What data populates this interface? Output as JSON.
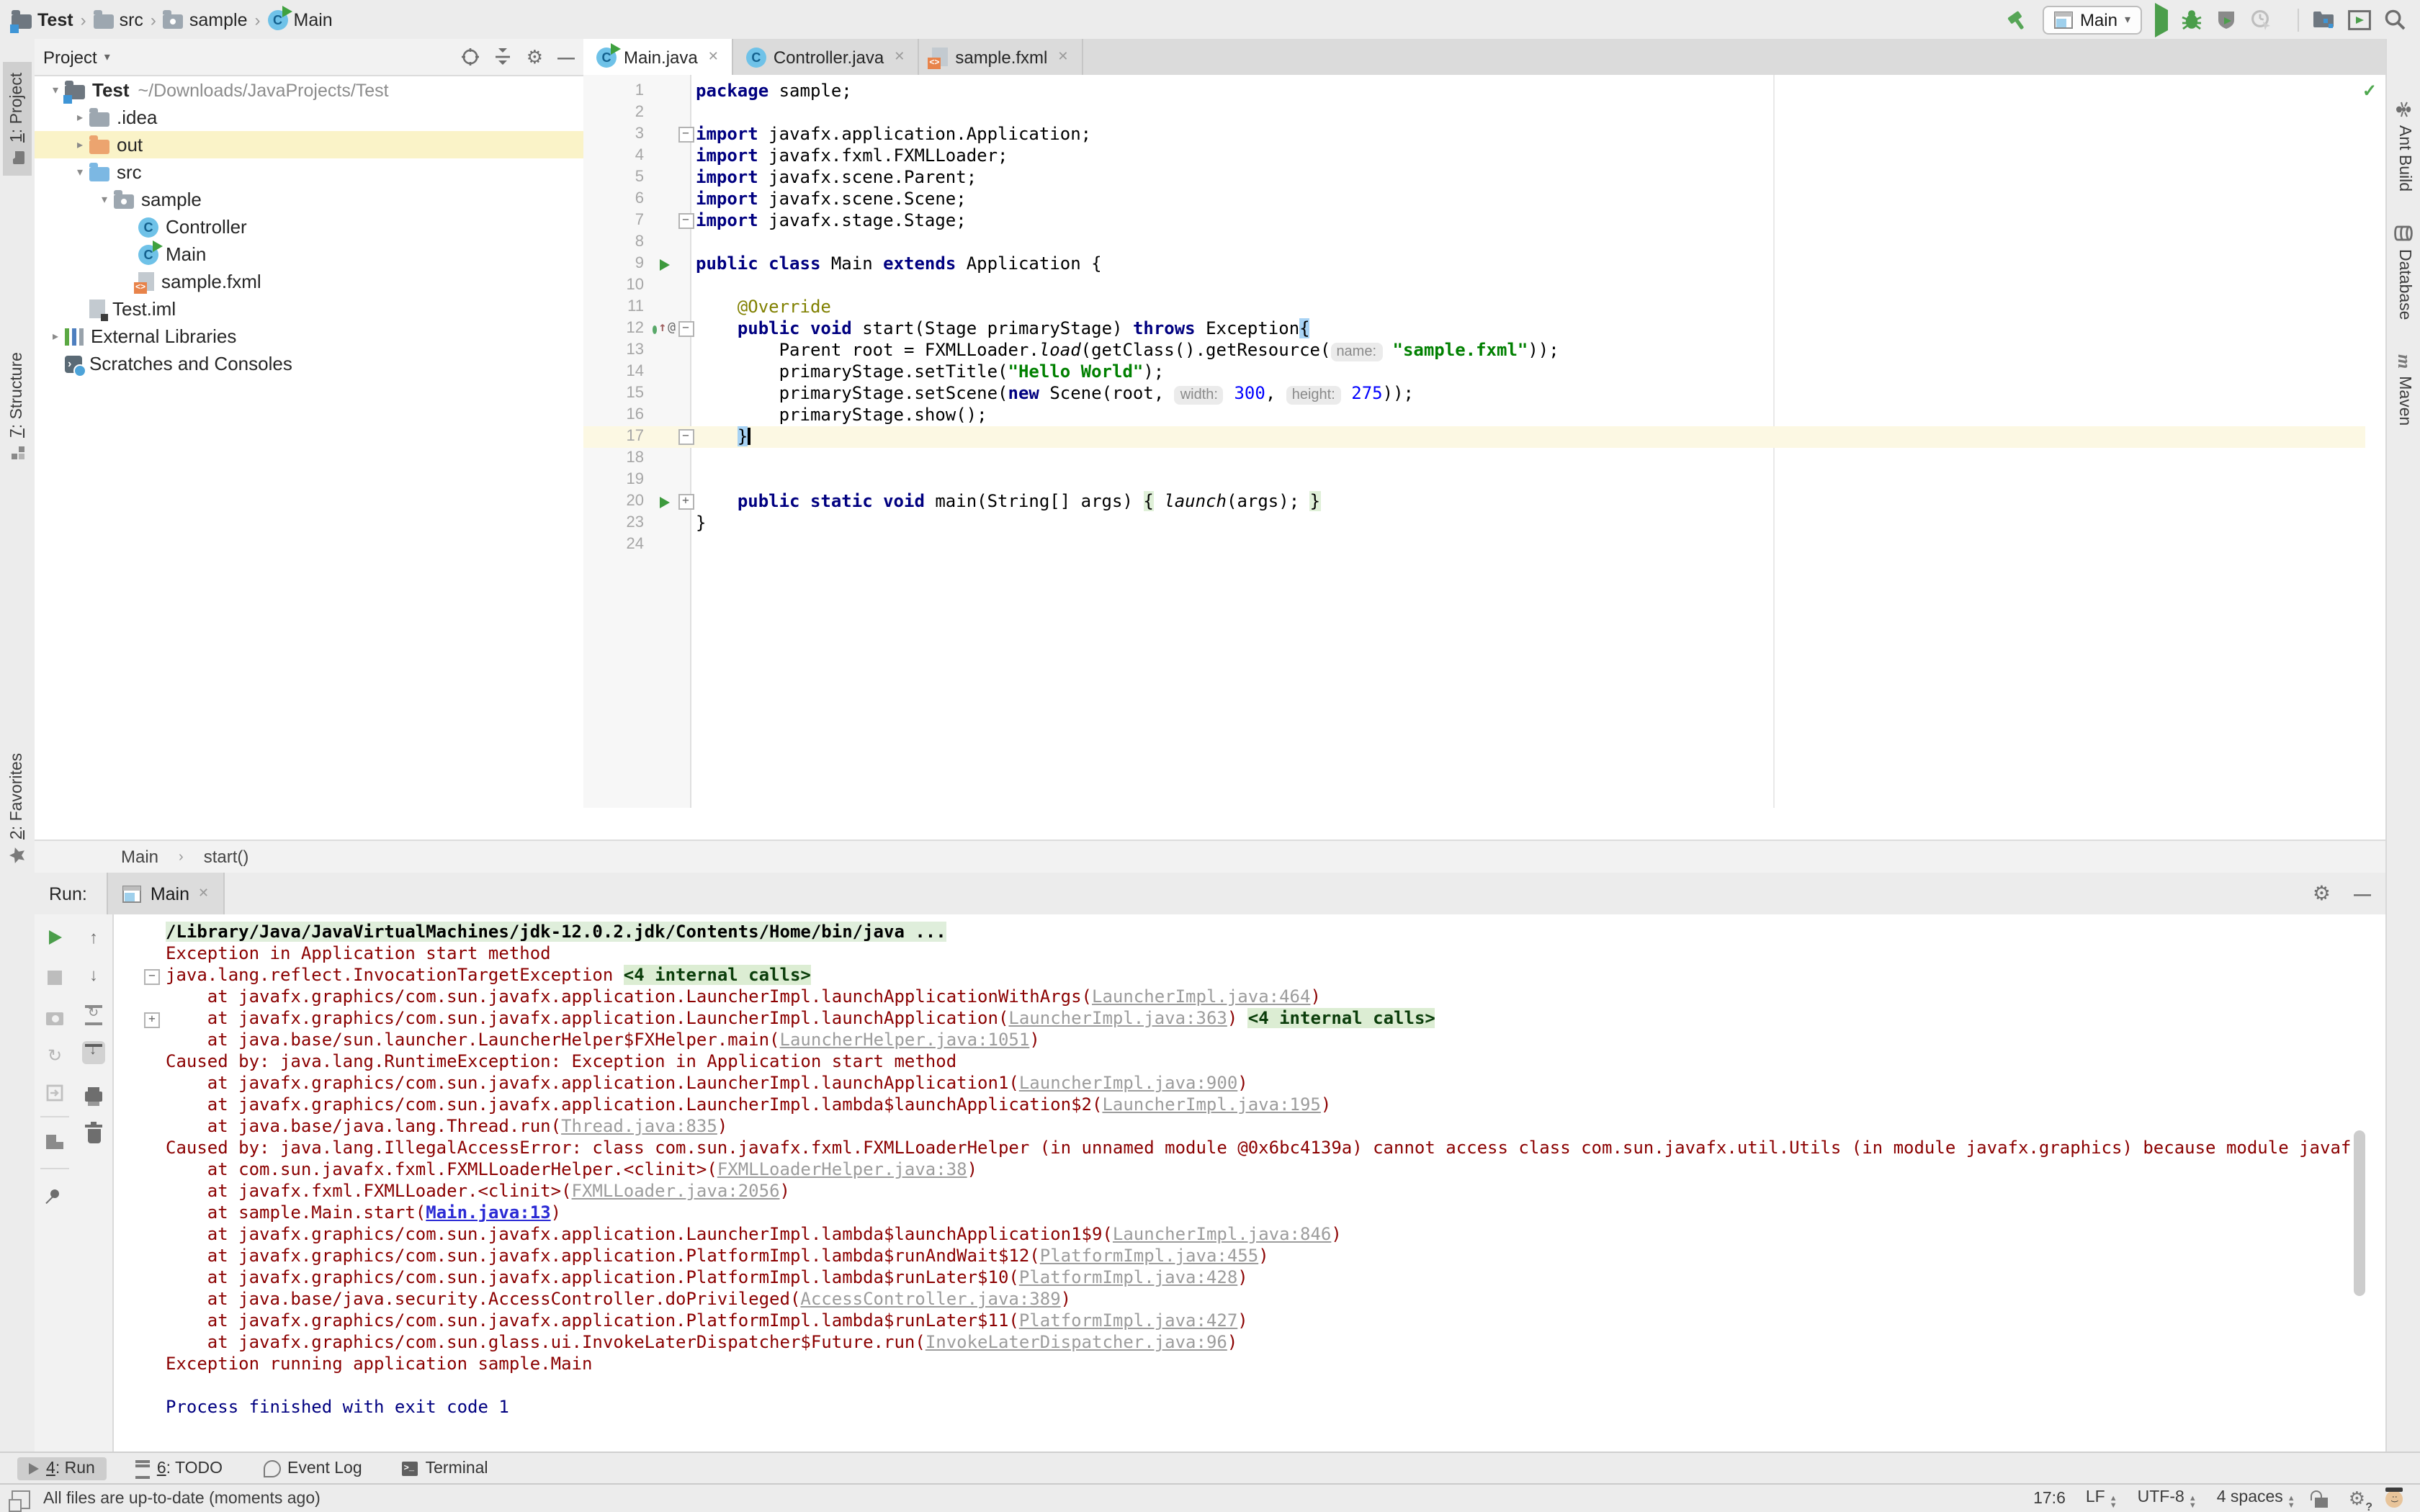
{
  "window": {
    "breadcrumbs": [
      {
        "label": "Test",
        "icon": "project"
      },
      {
        "label": "src",
        "icon": "folder-gray"
      },
      {
        "label": "sample",
        "icon": "package"
      },
      {
        "label": "Main",
        "icon": "class"
      }
    ]
  },
  "toolbar": {
    "run_config": "Main",
    "icons": [
      "build-hammer",
      "run",
      "debug",
      "run-with-coverage",
      "profiler",
      "stop",
      "project-structure",
      "run-anything",
      "search-everywhere"
    ]
  },
  "left_strip": {
    "items": [
      {
        "mnemonic": "1",
        "rest": ": Project",
        "icon": "project-tool",
        "active": true
      },
      {
        "mnemonic": "7",
        "rest": ": Structure",
        "icon": "structure-tool",
        "active": false
      },
      {
        "mnemonic": "2",
        "rest": ": Favorites",
        "icon": "star",
        "active": false
      }
    ]
  },
  "right_strip": {
    "items": [
      {
        "label": "Ant Build",
        "icon": "ant"
      },
      {
        "label": "Database",
        "icon": "database"
      },
      {
        "label": "Maven",
        "icon": "maven"
      }
    ]
  },
  "project_panel": {
    "title": "Project",
    "tree": [
      {
        "label": "Test",
        "path": "~/Downloads/JavaProjects/Test",
        "level": 0,
        "icon": "project",
        "arrow": "expanded",
        "bold": true,
        "selected": false
      },
      {
        "label": ".idea",
        "level": 1,
        "icon": "folder-gray",
        "arrow": "collapsed",
        "selected": false
      },
      {
        "label": "out",
        "level": 1,
        "icon": "folder-orange",
        "arrow": "collapsed",
        "selected": true
      },
      {
        "label": "src",
        "level": 1,
        "icon": "folder-blue",
        "arrow": "expanded",
        "selected": false
      },
      {
        "label": "sample",
        "level": 2,
        "icon": "package",
        "arrow": "expanded",
        "selected": false
      },
      {
        "label": "Controller",
        "level": 3,
        "icon": "class",
        "arrow": "none",
        "selected": false
      },
      {
        "label": "Main",
        "level": 3,
        "icon": "classrun",
        "arrow": "none",
        "selected": false
      },
      {
        "label": "sample.fxml",
        "level": 3,
        "icon": "fxml",
        "arrow": "none",
        "selected": false
      },
      {
        "label": "Test.iml",
        "level": 1,
        "icon": "file",
        "arrow": "none",
        "selected": false
      },
      {
        "label": "External Libraries",
        "level": 0,
        "icon": "libs",
        "arrow": "collapsed",
        "selected": false
      },
      {
        "label": "Scratches and Consoles",
        "level": 0,
        "icon": "scratch",
        "arrow": "none",
        "selected": false
      }
    ]
  },
  "editor": {
    "tabs": [
      {
        "label": "Main.java",
        "icon": "classrun",
        "active": true
      },
      {
        "label": "Controller.java",
        "icon": "class",
        "active": false
      },
      {
        "label": "sample.fxml",
        "icon": "fxml",
        "active": false
      }
    ],
    "breadcrumb": {
      "class": "Main",
      "method": "start()"
    },
    "lines": [
      {
        "num": "1",
        "segs": [
          {
            "t": "k",
            "s": "package"
          },
          {
            "t": "p",
            "s": " sample;"
          }
        ]
      },
      {
        "num": "2",
        "segs": []
      },
      {
        "num": "3",
        "fold": "minus",
        "segs": [
          {
            "t": "k",
            "s": "import"
          },
          {
            "t": "p",
            "s": " javafx.application.Application;"
          }
        ]
      },
      {
        "num": "4",
        "segs": [
          {
            "t": "k",
            "s": "import"
          },
          {
            "t": "p",
            "s": " javafx.fxml.FXMLLoader;"
          }
        ]
      },
      {
        "num": "5",
        "segs": [
          {
            "t": "k",
            "s": "import"
          },
          {
            "t": "p",
            "s": " javafx.scene.Parent;"
          }
        ]
      },
      {
        "num": "6",
        "segs": [
          {
            "t": "k",
            "s": "import"
          },
          {
            "t": "p",
            "s": " javafx.scene.Scene;"
          }
        ]
      },
      {
        "num": "7",
        "fold": "minus",
        "segs": [
          {
            "t": "k",
            "s": "import"
          },
          {
            "t": "p",
            "s": " javafx.stage.Stage;"
          }
        ]
      },
      {
        "num": "8",
        "segs": []
      },
      {
        "num": "9",
        "gutter": "run",
        "segs": [
          {
            "t": "k",
            "s": "public class"
          },
          {
            "t": "p",
            "s": " Main "
          },
          {
            "t": "k",
            "s": "extends"
          },
          {
            "t": "p",
            "s": " Application {"
          }
        ]
      },
      {
        "num": "10",
        "segs": []
      },
      {
        "num": "11",
        "segs": [
          {
            "t": "a",
            "s": "    @Override"
          }
        ]
      },
      {
        "num": "12",
        "gutter": "override",
        "fold": "minus",
        "segs": [
          {
            "t": "p",
            "s": "    "
          },
          {
            "t": "k",
            "s": "public void"
          },
          {
            "t": "p",
            "s": " start(Stage primaryStage) "
          },
          {
            "t": "k",
            "s": "throws"
          },
          {
            "t": "p",
            "s": " Exception"
          },
          {
            "t": "b",
            "s": "{"
          }
        ]
      },
      {
        "num": "13",
        "segs": [
          {
            "t": "p",
            "s": "        Parent root = FXMLLoader."
          },
          {
            "t": "i",
            "s": "load"
          },
          {
            "t": "p",
            "s": "(getClass().getResource("
          },
          {
            "t": "h",
            "s": "name:"
          },
          {
            "t": "p",
            "s": " "
          },
          {
            "t": "s",
            "s": "\"sample.fxml\""
          },
          {
            "t": "p",
            "s": "));"
          }
        ]
      },
      {
        "num": "14",
        "segs": [
          {
            "t": "p",
            "s": "        primaryStage.setTitle("
          },
          {
            "t": "s",
            "s": "\"Hello World\""
          },
          {
            "t": "p",
            "s": ");"
          }
        ]
      },
      {
        "num": "15",
        "segs": [
          {
            "t": "p",
            "s": "        primaryStage.setScene("
          },
          {
            "t": "k",
            "s": "new"
          },
          {
            "t": "p",
            "s": " Scene(root, "
          },
          {
            "t": "h",
            "s": "width:"
          },
          {
            "t": "p",
            "s": " "
          },
          {
            "t": "n",
            "s": "300"
          },
          {
            "t": "p",
            "s": ", "
          },
          {
            "t": "h",
            "s": "height:"
          },
          {
            "t": "p",
            "s": " "
          },
          {
            "t": "n",
            "s": "275"
          },
          {
            "t": "p",
            "s": "));"
          }
        ]
      },
      {
        "num": "16",
        "segs": [
          {
            "t": "p",
            "s": "        primaryStage.show();"
          }
        ]
      },
      {
        "num": "17",
        "fold": "minus",
        "highlight": true,
        "caret": true,
        "segs": [
          {
            "t": "p",
            "s": "    "
          },
          {
            "t": "b",
            "s": "}"
          }
        ]
      },
      {
        "num": "18",
        "segs": []
      },
      {
        "num": "19",
        "segs": []
      },
      {
        "num": "20",
        "gutter": "run",
        "fold": "plus",
        "segs": [
          {
            "t": "p",
            "s": "    "
          },
          {
            "t": "k",
            "s": "public static void"
          },
          {
            "t": "p",
            "s": " main(String[] args) "
          },
          {
            "t": "g",
            "s": "{"
          },
          {
            "t": "p",
            "s": " "
          },
          {
            "t": "i",
            "s": "launch"
          },
          {
            "t": "p",
            "s": "(args); "
          },
          {
            "t": "g",
            "s": "}"
          }
        ]
      },
      {
        "num": "23",
        "segs": [
          {
            "t": "p",
            "s": "}"
          }
        ]
      },
      {
        "num": "24",
        "segs": []
      }
    ]
  },
  "run_panel": {
    "label": "Run:",
    "tab": "Main",
    "console": [
      {
        "segs": [
          {
            "t": "c",
            "s": "/Library/Java/JavaVirtualMachines/jdk-12.0.2.jdk/Contents/Home/bin/java ..."
          }
        ]
      },
      {
        "segs": [
          {
            "t": "e",
            "s": "Exception in Application start method"
          }
        ]
      },
      {
        "fold": "minus",
        "segs": [
          {
            "t": "e",
            "s": "java.lang.reflect.InvocationTargetException "
          },
          {
            "t": "g",
            "s": "<4 internal calls>"
          }
        ]
      },
      {
        "segs": [
          {
            "t": "e",
            "s": "    at javafx.graphics/com.sun.javafx.application.LauncherImpl.launchApplicationWithArgs("
          },
          {
            "t": "l",
            "s": "LauncherImpl.java:464"
          },
          {
            "t": "e",
            "s": ")"
          }
        ]
      },
      {
        "fold": "plus",
        "segs": [
          {
            "t": "e",
            "s": "    at javafx.graphics/com.sun.javafx.application.LauncherImpl.launchApplication("
          },
          {
            "t": "l",
            "s": "LauncherImpl.java:363"
          },
          {
            "t": "e",
            "s": ") "
          },
          {
            "t": "g",
            "s": "<4 internal calls>"
          }
        ]
      },
      {
        "segs": [
          {
            "t": "e",
            "s": "    at java.base/sun.launcher.LauncherHelper$FXHelper.main("
          },
          {
            "t": "l",
            "s": "LauncherHelper.java:1051"
          },
          {
            "t": "e",
            "s": ")"
          }
        ]
      },
      {
        "segs": [
          {
            "t": "e",
            "s": "Caused by: java.lang.RuntimeException: Exception in Application start method"
          }
        ]
      },
      {
        "segs": [
          {
            "t": "e",
            "s": "    at javafx.graphics/com.sun.javafx.application.LauncherImpl.launchApplication1("
          },
          {
            "t": "l",
            "s": "LauncherImpl.java:900"
          },
          {
            "t": "e",
            "s": ")"
          }
        ]
      },
      {
        "segs": [
          {
            "t": "e",
            "s": "    at javafx.graphics/com.sun.javafx.application.LauncherImpl.lambda$launchApplication$2("
          },
          {
            "t": "l",
            "s": "LauncherImpl.java:195"
          },
          {
            "t": "e",
            "s": ")"
          }
        ]
      },
      {
        "segs": [
          {
            "t": "e",
            "s": "    at java.base/java.lang.Thread.run("
          },
          {
            "t": "l",
            "s": "Thread.java:835"
          },
          {
            "t": "e",
            "s": ")"
          }
        ]
      },
      {
        "segs": [
          {
            "t": "e",
            "s": "Caused by: java.lang.IllegalAccessError: class com.sun.javafx.fxml.FXMLLoaderHelper (in unnamed module @0x6bc4139a) cannot access class com.sun.javafx.util.Utils (in module javafx.graphics) because module javafx.graphics doe"
          }
        ]
      },
      {
        "segs": [
          {
            "t": "e",
            "s": "    at com.sun.javafx.fxml.FXMLLoaderHelper.<clinit>("
          },
          {
            "t": "l",
            "s": "FXMLLoaderHelper.java:38"
          },
          {
            "t": "e",
            "s": ")"
          }
        ]
      },
      {
        "segs": [
          {
            "t": "e",
            "s": "    at javafx.fxml.FXMLLoader.<clinit>("
          },
          {
            "t": "l",
            "s": "FXMLLoader.java:2056"
          },
          {
            "t": "e",
            "s": ")"
          }
        ]
      },
      {
        "segs": [
          {
            "t": "e",
            "s": "    at sample.Main.start("
          },
          {
            "t": "B",
            "s": "Main.java:13"
          },
          {
            "t": "e",
            "s": ")"
          }
        ]
      },
      {
        "segs": [
          {
            "t": "e",
            "s": "    at javafx.graphics/com.sun.javafx.application.LauncherImpl.lambda$launchApplication1$9("
          },
          {
            "t": "l",
            "s": "LauncherImpl.java:846"
          },
          {
            "t": "e",
            "s": ")"
          }
        ]
      },
      {
        "segs": [
          {
            "t": "e",
            "s": "    at javafx.graphics/com.sun.javafx.application.PlatformImpl.lambda$runAndWait$12("
          },
          {
            "t": "l",
            "s": "PlatformImpl.java:455"
          },
          {
            "t": "e",
            "s": ")"
          }
        ]
      },
      {
        "segs": [
          {
            "t": "e",
            "s": "    at javafx.graphics/com.sun.javafx.application.PlatformImpl.lambda$runLater$10("
          },
          {
            "t": "l",
            "s": "PlatformImpl.java:428"
          },
          {
            "t": "e",
            "s": ")"
          }
        ]
      },
      {
        "segs": [
          {
            "t": "e",
            "s": "    at java.base/java.security.AccessController.doPrivileged("
          },
          {
            "t": "l",
            "s": "AccessController.java:389"
          },
          {
            "t": "e",
            "s": ")"
          }
        ]
      },
      {
        "segs": [
          {
            "t": "e",
            "s": "    at javafx.graphics/com.sun.javafx.application.PlatformImpl.lambda$runLater$11("
          },
          {
            "t": "l",
            "s": "PlatformImpl.java:427"
          },
          {
            "t": "e",
            "s": ")"
          }
        ]
      },
      {
        "segs": [
          {
            "t": "e",
            "s": "    at javafx.graphics/com.sun.glass.ui.InvokeLaterDispatcher$Future.run("
          },
          {
            "t": "l",
            "s": "InvokeLaterDispatcher.java:96"
          },
          {
            "t": "e",
            "s": ")"
          }
        ]
      },
      {
        "segs": [
          {
            "t": "e",
            "s": "Exception running application sample.Main"
          }
        ]
      },
      {
        "segs": []
      },
      {
        "segs": [
          {
            "t": "x",
            "s": "Process finished with exit code 1"
          }
        ]
      }
    ]
  },
  "bottom_bar": {
    "items": [
      {
        "mnemonic": "4",
        "rest": ": Run",
        "icon": "run-tool",
        "active": true
      },
      {
        "mnemonic": "6",
        "rest": ": TODO",
        "icon": "todo-list",
        "active": false
      },
      {
        "mnemonic": "",
        "rest": "Event Log",
        "icon": "event-balloon",
        "active": false
      },
      {
        "mnemonic": "",
        "rest": "Terminal",
        "icon": "terminal",
        "active": false
      }
    ]
  },
  "status_bar": {
    "message": "All files are up-to-date (moments ago)",
    "position": "17:6",
    "line_ending": "LF",
    "encoding": "UTF-8",
    "indent": "4 spaces"
  },
  "colors": {
    "run_green": "#4B9E4B",
    "error_red": "#8B0000",
    "link_gray": "#9C9C9C",
    "link_blue": "#2B2BD5",
    "keyword": "#000080",
    "string_green": "#008000",
    "number_blue": "#0000FF",
    "selection_yellow": "#FAF3C8",
    "current_line": "#FCF8E3",
    "highlight_green_bg": "#DCEDD3"
  }
}
